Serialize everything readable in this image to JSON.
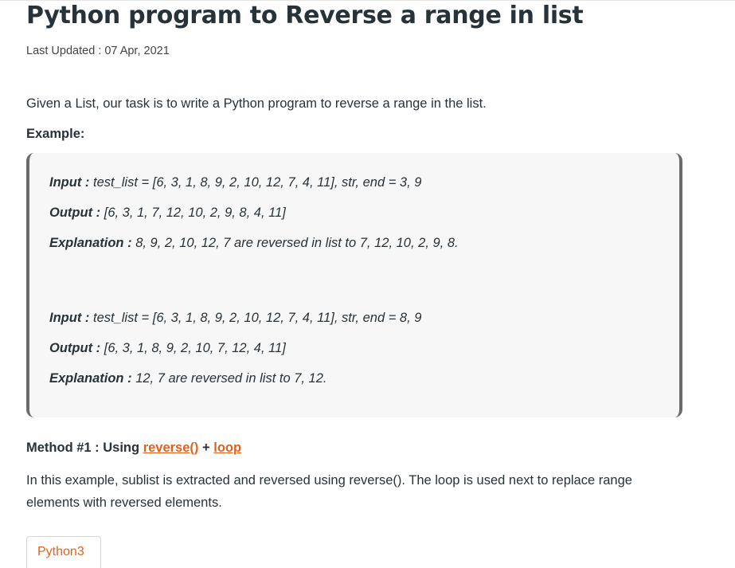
{
  "article": {
    "title": "Python program to Reverse a range in list",
    "last_updated": "Last Updated : 07 Apr, 2021",
    "intro": "Given a List, our task is to write a Python program to reverse a range in the list.",
    "example_label": "Example:",
    "examples": [
      {
        "input_label": "Input :",
        "input": "test_list = [6, 3, 1, 8, 9, 2, 10, 12, 7, 4, 11], str, end = 3, 9",
        "output_label": "Output :",
        "output": "[6, 3, 1, 7, 12, 10, 2, 9, 8, 4, 11]",
        "explanation_label": "Explanation :",
        "explanation": "8, 9, 2, 10, 12, 7 are reversed in list to 7, 12, 10, 2, 9, 8."
      },
      {
        "input_label": "Input :",
        "input": "test_list = [6, 3, 1, 8, 9, 2, 10, 12, 7, 4, 11], str, end = 8, 9",
        "output_label": "Output :",
        "output": "[6, 3, 1, 8, 9, 2, 10, 7, 12, 4, 11]",
        "explanation_label": "Explanation :",
        "explanation": "12, 7 are reversed in list to 7, 12."
      }
    ],
    "method": {
      "prefix": "Method #1 : Using",
      "link1": "reverse()",
      "plus": "+",
      "link2": "loop"
    },
    "method_description": "In this example, sublist is extracted and reversed using reverse(). The loop is used next to replace range elements with reversed elements.",
    "code_tab": "Python3"
  },
  "colors": {
    "link": "#e0621f",
    "text": "#273239",
    "example_bg": "#f7f7f7",
    "example_border": "#6b6b6b"
  }
}
